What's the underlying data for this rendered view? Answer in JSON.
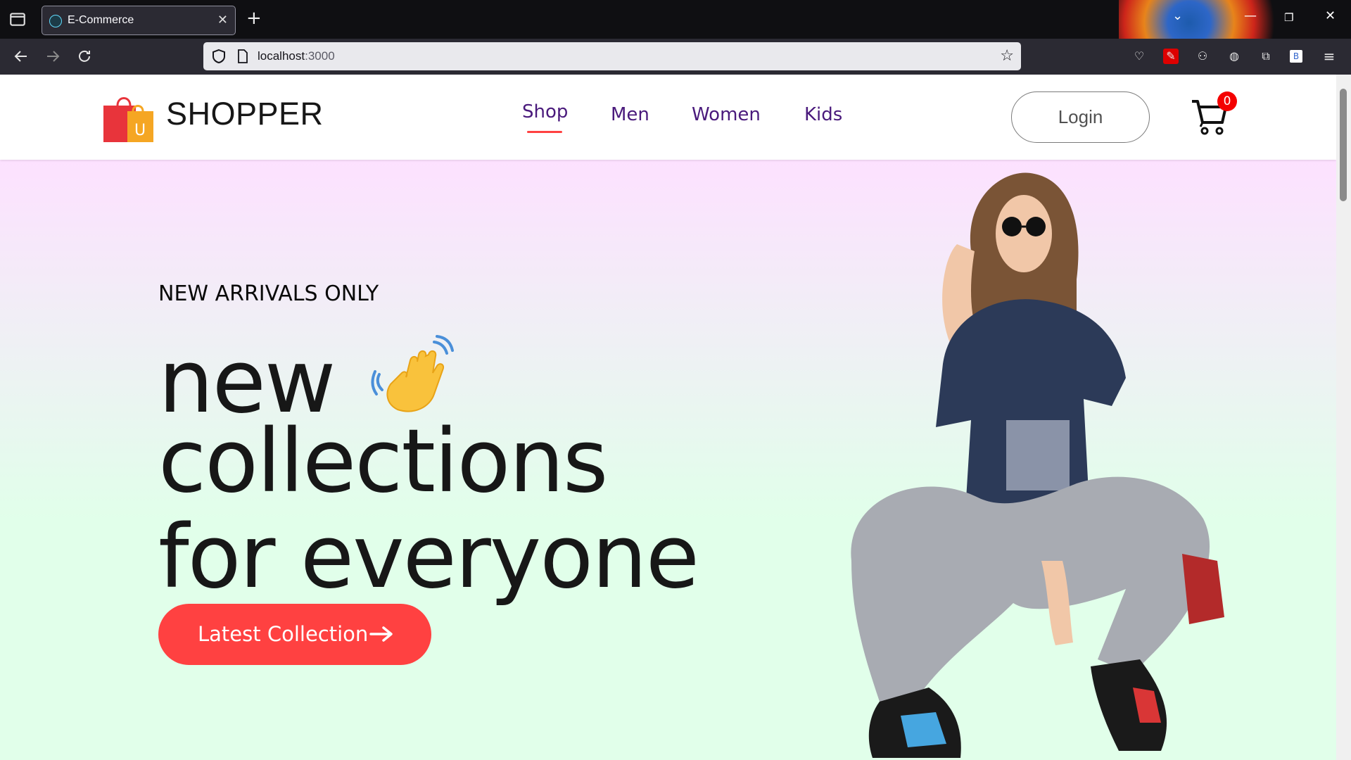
{
  "browser": {
    "tab_title": "E-Commerce",
    "tab_close": "✕",
    "new_tab": "+",
    "url_host": "localhost",
    "url_port": ":3000",
    "window_controls": [
      "—",
      "❐",
      "✕"
    ],
    "extension_badge": "B"
  },
  "header": {
    "logo_text": "SHOPPER",
    "nav": [
      "Shop",
      "Men",
      "Women",
      "Kids"
    ],
    "active_nav": "Shop",
    "login_label": "Login",
    "cart_count": "0"
  },
  "hero": {
    "tag": "NEW ARRIVALS ONLY",
    "line1": "new",
    "line2": "collections",
    "line3": "for everyone",
    "cta_label": "Latest Collection"
  },
  "colors": {
    "accent": "#ff4141",
    "nav_text": "#4a1a7c",
    "hero_gradient_top": "#fde1ff",
    "hero_gradient_bottom": "#e1ffea"
  },
  "icons": [
    "tab-list-icon",
    "react-favicon-icon",
    "back-arrow-icon",
    "forward-arrow-icon",
    "reload-icon",
    "shield-icon",
    "page-icon",
    "bookmark-star-icon",
    "pocket-icon",
    "extension-icon",
    "menu-icon",
    "shopping-bag-icon",
    "cart-icon",
    "waving-hand-icon",
    "arrow-right-icon"
  ]
}
